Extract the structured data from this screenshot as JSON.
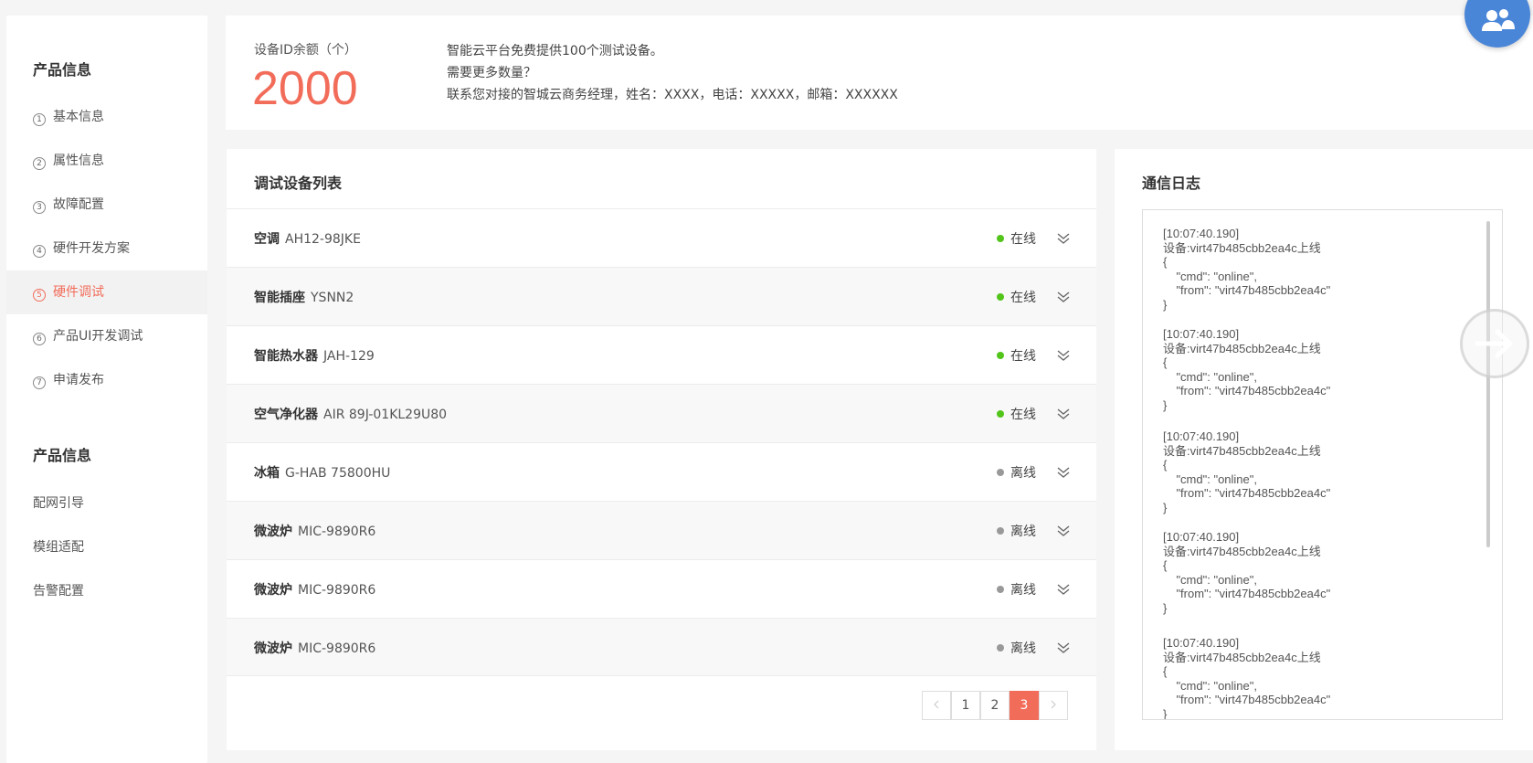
{
  "sidebar": {
    "section1_title": "产品信息",
    "items": [
      {
        "num": "1",
        "label": "基本信息"
      },
      {
        "num": "2",
        "label": "属性信息"
      },
      {
        "num": "3",
        "label": "故障配置"
      },
      {
        "num": "4",
        "label": "硬件开发方案"
      },
      {
        "num": "5",
        "label": "硬件调试"
      },
      {
        "num": "6",
        "label": "产品UI开发调试"
      },
      {
        "num": "7",
        "label": "申请发布"
      }
    ],
    "section2_title": "产品信息",
    "items2": [
      {
        "label": "配网引导"
      },
      {
        "label": "模组适配"
      },
      {
        "label": "告警配置"
      }
    ]
  },
  "quota": {
    "label": "设备ID余额（个）",
    "value": "2000",
    "info": [
      "智能云平台免费提供100个测试设备。",
      "需要更多数量？",
      "联系您对接的智城云商务经理，姓名：XXXX，电话：XXXXX，邮箱：XXXXXX"
    ]
  },
  "devices": {
    "title": "调试设备列表",
    "rows": [
      {
        "name": "空调",
        "code": "AH12-98JKE",
        "status": "在线"
      },
      {
        "name": "智能插座",
        "code": "YSNN2",
        "status": "在线"
      },
      {
        "name": "智能热水器",
        "code": "JAH-129",
        "status": "在线"
      },
      {
        "name": "空气净化器",
        "code": "AIR 89J-01KL29U80",
        "status": "在线"
      },
      {
        "name": "冰箱",
        "code": "G-HAB 75800HU",
        "status": "离线"
      },
      {
        "name": "微波炉",
        "code": "MIC-9890R6",
        "status": "离线"
      },
      {
        "name": "微波炉",
        "code": "MIC-9890R6",
        "status": "离线"
      },
      {
        "name": "微波炉",
        "code": "MIC-9890R6",
        "status": "离线"
      }
    ],
    "pages": [
      "1",
      "2",
      "3"
    ],
    "current_page": "3"
  },
  "logs": {
    "title": "通信日志",
    "entries": [
      {
        "time": "[10:07:40.190]",
        "msg": "设备:virt47b485cbb2ea4c上线",
        "body": "{\n    \"cmd\": \"online\",\n    \"from\": \"virt47b485cbb2ea4c\"\n}"
      },
      {
        "time": "[10:07:40.190]",
        "msg": "设备:virt47b485cbb2ea4c上线",
        "body": "{\n    \"cmd\": \"online\",\n    \"from\": \"virt47b485cbb2ea4c\"\n}"
      },
      {
        "time": "[10:07:40.190]",
        "msg": "设备:virt47b485cbb2ea4c上线",
        "body": "{\n    \"cmd\": \"online\",\n    \"from\": \"virt47b485cbb2ea4c\"\n}"
      },
      {
        "time": "[10:07:40.190]",
        "msg": "设备:virt47b485cbb2ea4c上线",
        "body": "{\n    \"cmd\": \"online\",\n    \"from\": \"virt47b485cbb2ea4c\"\n}"
      },
      {
        "time": "[10:07:40.190]",
        "msg": "设备:virt47b485cbb2ea4c上线",
        "body": "{\n    \"cmd\": \"online\",\n    \"from\": \"virt47b485cbb2ea4c\"\n}"
      }
    ]
  },
  "colors": {
    "accent": "#f26c5a",
    "online": "#52c41a",
    "offline": "#999999",
    "fab": "#4a86d8"
  },
  "icons": {
    "fab": "users-icon",
    "next": "arrow-right-icon",
    "expand": "chevron-double-down-icon"
  }
}
